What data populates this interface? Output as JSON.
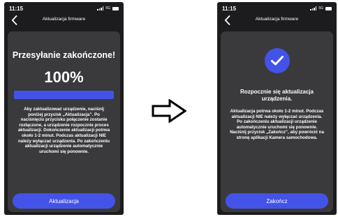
{
  "left_screen": {
    "status": {
      "time": "11:15",
      "network": "5G"
    },
    "nav_title": "Aktualizacja firmware",
    "headline": "Przesyłanie zakończone!",
    "progress_text": "100%",
    "progress_value": 1.0,
    "body": "Aby zaktualizować urządzenie, naciśnij poniżej przycisk „Aktualizacja”. Po naciśnięciu przycisku połączenie zostanie rozłączone, a urządzenie rozpocznie proces aktualizacji. Dokończenie aktualizacji potrwa około 1-2 minut. Podczas aktualizacji NIE należy wyłączać urządzenia. Po zakończeniu aktualizacji urządzenie automatycznie uruchomi się ponownie.",
    "button_label": "Aktualizacja"
  },
  "right_screen": {
    "status": {
      "time": "11:15",
      "network": "5G"
    },
    "nav_title": "Aktualizacja firmware",
    "headline": "Rozpocznie się aktualizacja urządzenia.",
    "body": "Aktualizacja potrwa około 1-2 minut. Podczas aktualizacji NIE należy wyłączać urządzenia. Po zakończeniu aktualizacji urządzenie automatycznie uruchomi się ponownie. Naciśnij przycisk „Zakończ”, aby powrócić na stronę aplikacji Kamera samochodowa.",
    "button_label": "Zakończ"
  },
  "colors": {
    "accent": "#4353e8",
    "screen_bg": "#1c1c1e",
    "card_bg": "#3a3a3c",
    "text": "#ffffff"
  },
  "icons": [
    "back-chevron-icon",
    "signal-icon",
    "battery-icon",
    "checkmark-icon",
    "right-arrow-icon"
  ]
}
